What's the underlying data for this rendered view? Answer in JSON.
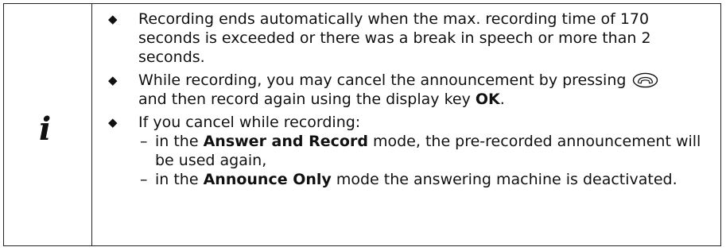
{
  "note": {
    "icon": "info-i-icon",
    "icon_glyph": "i",
    "bullet_glyph": "◆",
    "dash_glyph": "–",
    "items": [
      {
        "text": "Recording ends automatically when the max. recording time of 170 seconds is exceeded or there was a break in speech or more than 2 seconds."
      },
      {
        "text_before": "While recording, you may cancel the announcement by pressing",
        "key_icon": "end-call-key-icon",
        "text_middle": "and then record again using the display key",
        "key_label": "OK",
        "text_after": "."
      },
      {
        "text": "If you cancel while recording:",
        "sub_items": [
          {
            "text_before": "in the",
            "mode": "Answer and Record",
            "text_after": "mode, the pre-recorded announcement will be used again,"
          },
          {
            "text_before": "in the",
            "mode": "Announce Only",
            "text_after": "mode the answering machine is deactivated."
          }
        ]
      }
    ]
  }
}
